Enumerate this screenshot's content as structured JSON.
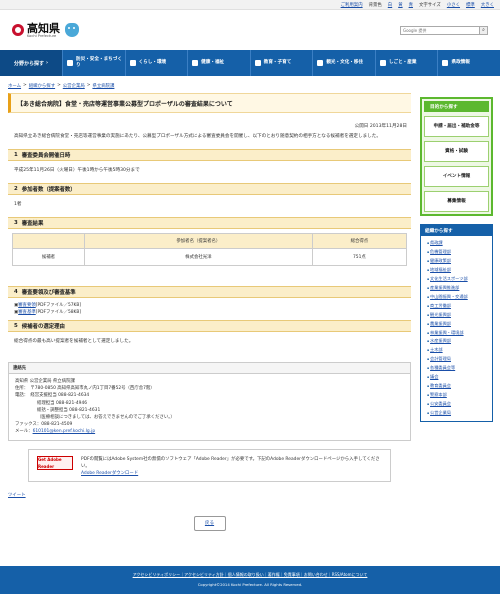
{
  "topbar": {
    "guide": "ご利用案内",
    "bg_label": "背景色",
    "bg_white": "白",
    "bg_yellow": "黄",
    "bg_blue": "青",
    "fontsize_label": "文字サイズ",
    "size_small": "小さく",
    "size_normal": "標準",
    "size_large": "大きく"
  },
  "header": {
    "logo_jp": "高知県",
    "logo_en": "Kochi Prefecture",
    "search_placeholder": "Google 提供"
  },
  "gnav": {
    "field_label": "分野から探す",
    "items": [
      {
        "label": "防災・安全・まちづくり"
      },
      {
        "label": "くらし・環境"
      },
      {
        "label": "健康・福祉"
      },
      {
        "label": "教育・子育て"
      },
      {
        "label": "観光・文化・移住"
      },
      {
        "label": "しごと・産業"
      },
      {
        "label": "県政情報"
      }
    ]
  },
  "breadcrumb": [
    "ホーム",
    "組織から探す",
    "公営企業局",
    "県立病院課"
  ],
  "main": {
    "title": "【あき総合病院】食堂・売店等運営事業公募型プロポーザルの審査結果について",
    "pub_date": "公開日 2013年11月28日",
    "intro": "高知県立あき総合病院食堂・売店等運営事業の実施にあたり、公募型プロポーザル方式による審査委員会を開催し、以下のとおり随意契約の相手方となる候補者を選定しました。",
    "sections": [
      {
        "num": "1",
        "title": "審査委員会開催日時",
        "body": "平成25年11月26日（火曜日）午後1時から午後5時30分まで"
      },
      {
        "num": "2",
        "title": "参加者数（提案者数）",
        "body": "1者"
      },
      {
        "num": "3",
        "title": "審査結果",
        "body": ""
      },
      {
        "num": "4",
        "title": "審査要領及び審査基準",
        "body": ""
      },
      {
        "num": "5",
        "title": "候補者の選定理由",
        "body": "総合得点の最も高い提案者を候補者として選定しました。"
      }
    ],
    "table": {
      "headers": [
        "",
        "参加者名（提案者名）",
        "総合得点"
      ],
      "rows": [
        [
          "候補者",
          "株式会社光洋",
          "751点"
        ]
      ]
    },
    "docs": [
      {
        "link": "審査要領",
        "meta": "[PDFファイル／57KB]"
      },
      {
        "link": "審査基準",
        "meta": "[PDFファイル／58KB]"
      }
    ],
    "contact": {
      "title": "連絡先",
      "dept": "高知県 公営企業局 県立病院課",
      "address": "住所：　〒780-0850 高知県高知市丸ノ内1丁目7番52号（西庁舎7階）",
      "tel1": "電話：　経営支援担当 088-821-4634",
      "tel2": "経理担当 088-821-4946",
      "tel3": "総括・調整担当 088-821-4631",
      "tel4": "（医療相談につきましては、お答えできませんのでご了承ください。）",
      "fax": "ファックス：088-821-4509",
      "mail_label": "メール：",
      "mail": "610101@ken.pref.kochi.lg.jp"
    },
    "pdf_note": {
      "icon_text": "Get Adobe Reader",
      "text": "PDFの閲覧にはAdobe System社の無償のソフトウェア「Adobe Reader」が必要です。下記のAdobe Readerダウンロードページから入手してください。",
      "link": "Adobe Readerダウンロード"
    },
    "tweet": "ツイート",
    "back": "戻る"
  },
  "sidebar": {
    "purpose_title": "目的から探す",
    "purpose_buttons": [
      "申請・届出・補助金等",
      "資格・試験",
      "イベント情報",
      "募集情報"
    ],
    "org_title": "組織から探す",
    "org_items": [
      "県政課",
      "危機管理部",
      "健康政策部",
      "地域福祉部",
      "文化生活スポーツ部",
      "産業振興推進部",
      "中山間振興・交通部",
      "商工労働部",
      "観光振興部",
      "農業振興部",
      "林業振興・環境部",
      "水産振興部",
      "土木部",
      "会計管理局",
      "各種委員会等",
      "議会",
      "教育委員会",
      "警察本部",
      "公安委員会",
      "公営企業局"
    ]
  },
  "footer": {
    "links": "アクセシビリティポリシー｜アクセシビリティ方針｜個人情報の取り扱い｜著作権｜免責事項｜お問い合わせ｜RSS/Atomについて",
    "copy": "Copyright©2014 Kochi Prefecture. All Rights Reserved."
  }
}
